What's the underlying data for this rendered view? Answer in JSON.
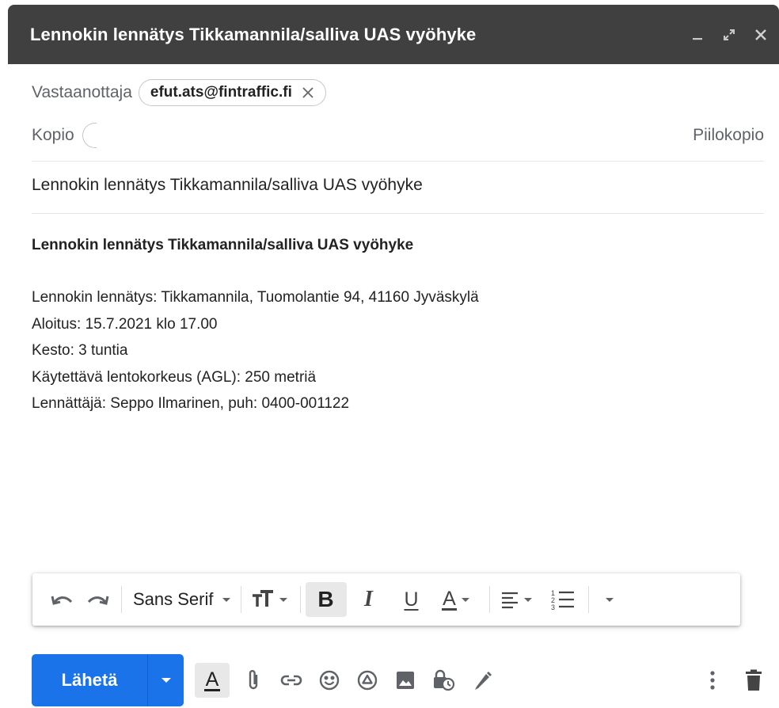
{
  "window": {
    "title": "Lennokin lennätys Tikkamannila/salliva UAS vyöhyke",
    "controls": [
      "minimize-icon",
      "expand-icon",
      "close-icon"
    ]
  },
  "recipients": {
    "to_label": "Vastaanottaja",
    "to_chip": "efut.ats@fintraffic.fi",
    "cc_label": "Kopio",
    "bcc_label": "Piilokopio"
  },
  "subject": "Lennokin lennätys Tikkamannila/salliva UAS vyöhyke",
  "body": {
    "heading": "Lennokin lennätys Tikkamannila/salliva UAS vyöhyke",
    "lines": [
      "Lennokin lennätys: Tikkamannila, Tuomolantie 94, 41160 Jyväskylä",
      "Aloitus: 15.7.2021 klo 17.00",
      "Kesto: 3 tuntia",
      "Käytettävä lentokorkeus (AGL): 250 metriä",
      "Lennättäjä: Seppo Ilmarinen, puh: 0400-001122"
    ]
  },
  "formatting_bar": {
    "font": "Sans Serif",
    "bold_glyph": "B",
    "italic_glyph": "I",
    "underline_glyph": "U",
    "color_glyph": "A",
    "icons": [
      "undo-icon",
      "redo-icon",
      "font-size-icon",
      "align-icon",
      "numbered-list-icon",
      "more-formatting-icon"
    ]
  },
  "bottom_bar": {
    "send_label": "Lähetä",
    "format_toggle_glyph": "A",
    "icons": [
      "attach-icon",
      "link-icon",
      "emoji-icon",
      "drive-icon",
      "photo-icon",
      "confidential-icon",
      "signature-icon",
      "more-options-icon",
      "trash-icon"
    ]
  },
  "colors": {
    "titlebar": "#404040",
    "send_button": "#1a73e8",
    "label_gray": "#5f6368"
  }
}
